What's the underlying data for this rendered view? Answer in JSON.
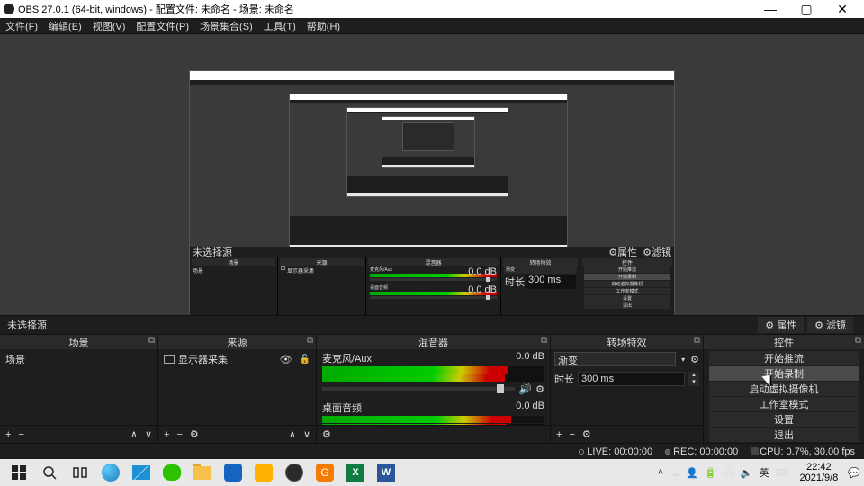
{
  "window": {
    "title": "OBS 27.0.1 (64-bit, windows) - 配置文件: 未命名 - 场景: 未命名"
  },
  "menu": [
    "文件(F)",
    "编辑(E)",
    "视图(V)",
    "配置文件(P)",
    "场景集合(S)",
    "工具(T)",
    "帮助(H)"
  ],
  "nosource": {
    "label": "未选择源",
    "prop": "属性",
    "filter": "滤镜"
  },
  "docks": {
    "scenes": "场景",
    "sources": "来源",
    "mixer": "混音器",
    "transitions": "转场特效",
    "controls": "控件"
  },
  "scenes": {
    "items": [
      {
        "name": "场景"
      }
    ]
  },
  "sources": {
    "items": [
      {
        "name": "显示器采集"
      }
    ]
  },
  "mixer": {
    "channels": [
      {
        "name": "麦克风/Aux",
        "db": "0.0 dB"
      },
      {
        "name": "桌面音频",
        "db": "0.0 dB"
      }
    ]
  },
  "transitions": {
    "selected": "渐变",
    "duration_label": "时长",
    "duration": "300 ms"
  },
  "controls": {
    "buttons": [
      "开始推流",
      "开始录制",
      "启动虚拟摄像机",
      "工作室模式",
      "设置",
      "退出"
    ]
  },
  "status": {
    "live": "LIVE: 00:00:00",
    "rec": "REC: 00:00:00",
    "cpu": "CPU: 0.7%, 30.00 fps"
  },
  "tray": {
    "ime": "英",
    "time": "22:42",
    "date": "2021/9/8"
  },
  "colors": {
    "edge": "#1b7fbf",
    "mail": "#1e90d4",
    "wechat": "#2dc100",
    "folder": "#f7c04a",
    "meet": "#1565c0",
    "360": "#ffb300",
    "obs": "#333",
    "orange": "#f57c00",
    "excel": "#107c41",
    "word": "#2b579a"
  }
}
